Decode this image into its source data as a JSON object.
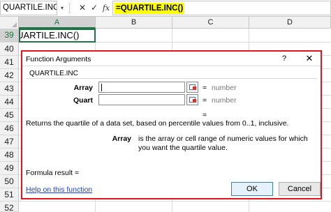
{
  "formula_bar": {
    "name_box": "QUARTILE.INC",
    "dropdown_glyph": "▾",
    "cancel_glyph": "✕",
    "enter_glyph": "✓",
    "fx_glyph": "fx",
    "formula": "=QUARTILE.INC()"
  },
  "columns": [
    "A",
    "B",
    "C",
    "D"
  ],
  "rows": [
    "39",
    "40",
    "41",
    "42",
    "43",
    "44",
    "45",
    "46",
    "47",
    "48",
    "49",
    "50",
    "51",
    "52"
  ],
  "active_cell_text": "QUARTILE.INC()",
  "dialog": {
    "title": "Function Arguments",
    "help_glyph": "?",
    "close_glyph": "✕",
    "function_name": "QUARTILE.INC",
    "arguments": [
      {
        "name": "Array",
        "value": "",
        "equals": "=",
        "result": "number"
      },
      {
        "name": "Quart",
        "value": "",
        "equals": "=",
        "result": "number"
      }
    ],
    "result_equals": "=",
    "description": "Returns the quartile of a data set, based on percentile values from 0..1, inclusive.",
    "arg_help_name": "Array",
    "arg_help_text": "is the array or cell range of numeric values for which you want the quartile value.",
    "formula_result": "Formula result =",
    "help_link": "Help on this function",
    "ok_label": "OK",
    "cancel_label": "Cancel"
  },
  "colors": {
    "dialog_border": "#e2131b",
    "formula_highlight": "#ffff00",
    "selection_green": "#217346",
    "link_blue": "#1a3fd6"
  }
}
